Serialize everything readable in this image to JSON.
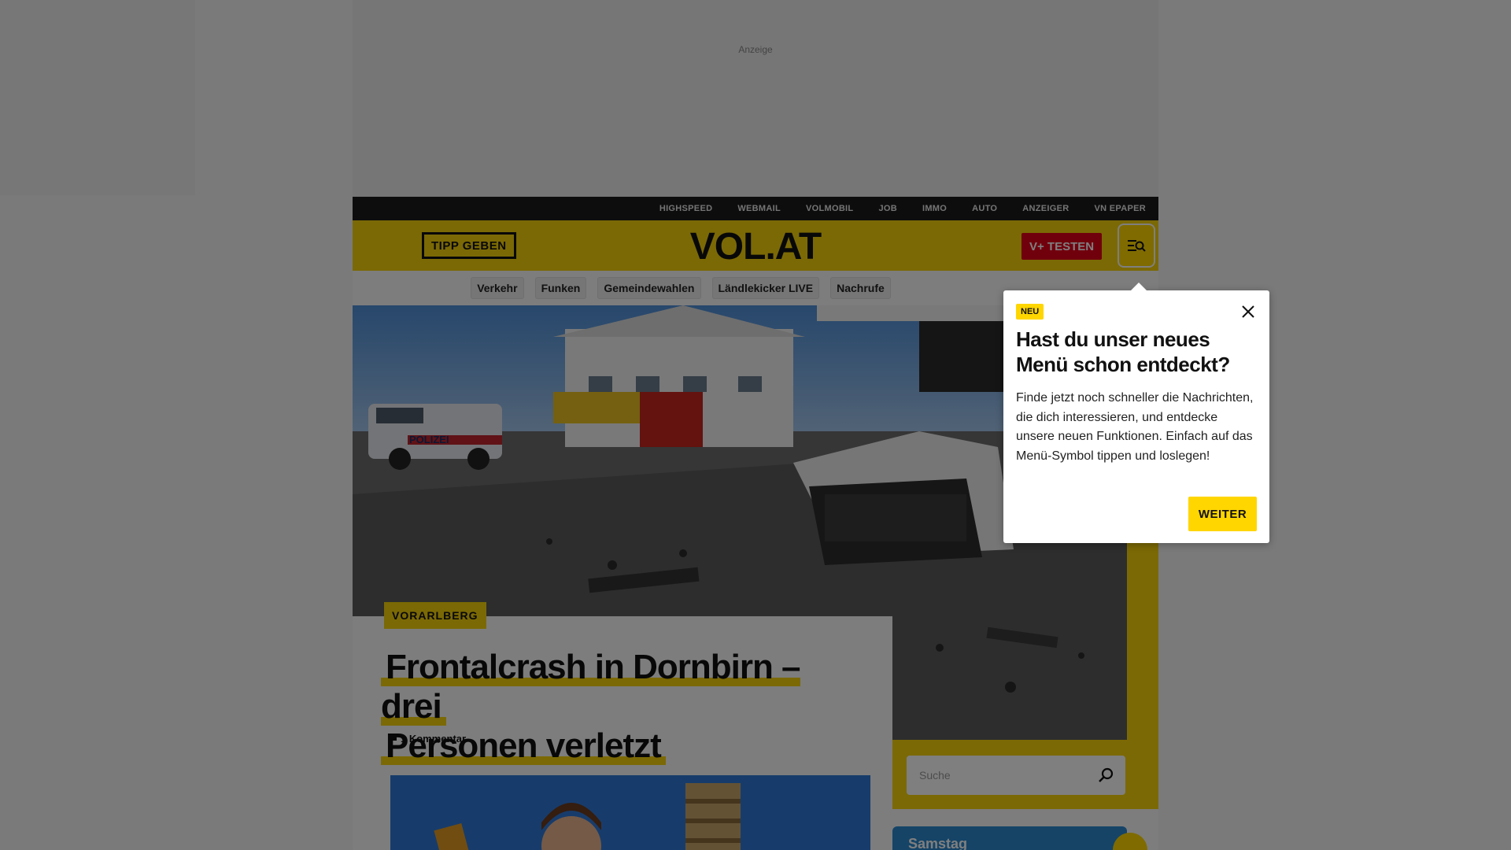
{
  "ad": {
    "label": "Anzeige"
  },
  "topbar": {
    "links": [
      "HIGHSPEED",
      "WEBMAIL",
      "VOLMOBIL",
      "JOB",
      "IMMO",
      "AUTO",
      "ANZEIGER",
      "VN EPAPER"
    ]
  },
  "header": {
    "tipp_label": "TIPP GEBEN",
    "logo": "VOL.AT",
    "vplus_label": "V+ TESTEN"
  },
  "subnav": {
    "items": [
      "Verkehr",
      "Funken",
      "Gemeindewahlen",
      "Ländlekicker LIVE",
      "Nachrufe"
    ]
  },
  "article": {
    "tag": "VORARLBERG",
    "headline_line1": "Frontalcrash in Dornbirn – drei",
    "headline_line2": "Personen verletzt",
    "comments": "1 Kommentar"
  },
  "search": {
    "placeholder": "Suche"
  },
  "weather": {
    "day": "Samstag"
  },
  "popup": {
    "badge": "NEU",
    "title": "Hast du unser neues Menü schon entdeckt?",
    "text": "Finde jetzt noch schneller die Nachrichten, die dich interessieren, und entdecke unsere neuen Funktionen. Einfach auf das Menü-Symbol tippen und loslegen!",
    "button": "WEITER"
  },
  "colors": {
    "brand_yellow": "#f7d20b",
    "vplus_red": "#e2001a",
    "topbar": "#1a1a1a"
  }
}
